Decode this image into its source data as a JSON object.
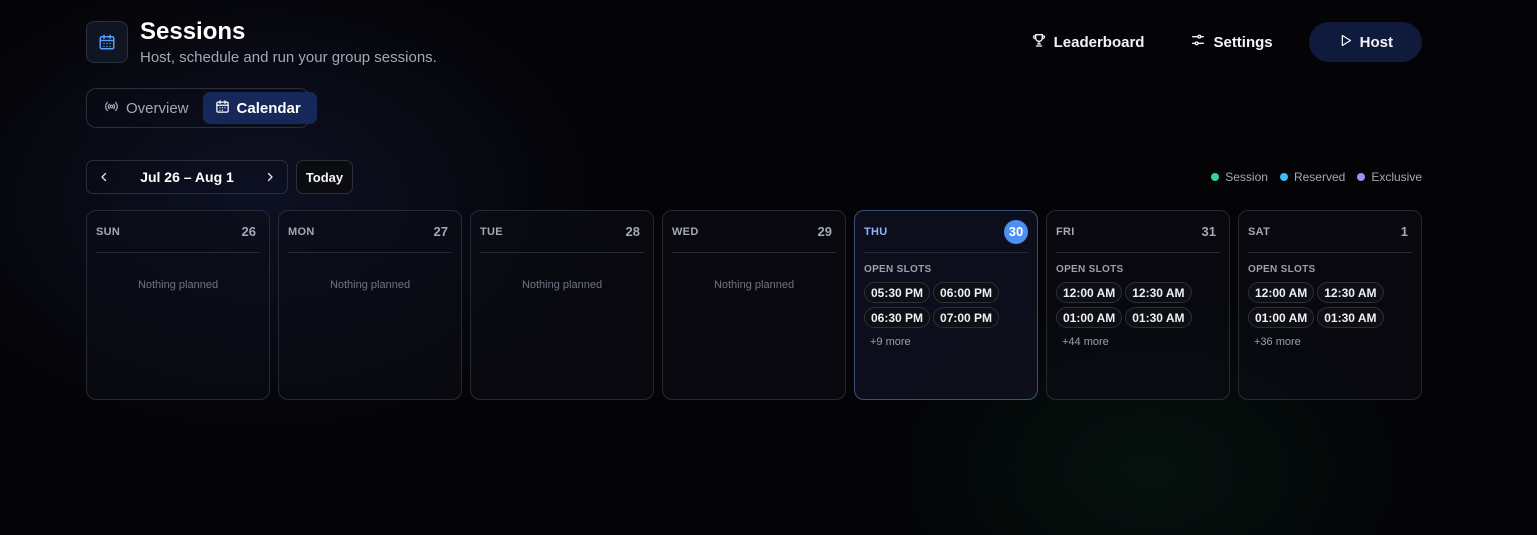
{
  "header": {
    "title": "Sessions",
    "subtitle": "Host, schedule and run your group sessions.",
    "actions": {
      "leaderboard": "Leaderboard",
      "settings": "Settings",
      "host": "Host"
    }
  },
  "tabs": [
    {
      "label": "Overview",
      "icon": "broadcast-icon",
      "active": false
    },
    {
      "label": "Calendar",
      "icon": "calendar-icon",
      "active": true
    }
  ],
  "range": {
    "label": "Jul 26 – Aug 1",
    "today": "Today"
  },
  "legend": [
    {
      "label": "Session",
      "color": "#34d399"
    },
    {
      "label": "Reserved",
      "color": "#38bdf8"
    },
    {
      "label": "Exclusive",
      "color": "#a78bfa"
    }
  ],
  "days": [
    {
      "dow": "SUN",
      "num": "26",
      "empty": "Nothing planned"
    },
    {
      "dow": "MON",
      "num": "27",
      "empty": "Nothing planned"
    },
    {
      "dow": "TUE",
      "num": "28",
      "empty": "Nothing planned"
    },
    {
      "dow": "WED",
      "num": "29",
      "empty": "Nothing planned"
    },
    {
      "dow": "THU",
      "num": "30",
      "slots_label": "OPEN SLOTS",
      "slots": [
        "05:30 PM",
        "06:00 PM",
        "06:30 PM",
        "07:00 PM"
      ],
      "more": "+9 more",
      "today": true
    },
    {
      "dow": "FRI",
      "num": "31",
      "slots_label": "OPEN SLOTS",
      "slots": [
        "12:00 AM",
        "12:30 AM",
        "01:00 AM",
        "01:30 AM"
      ],
      "more": "+44 more"
    },
    {
      "dow": "SAT",
      "num": "1",
      "slots_label": "OPEN SLOTS",
      "slots": [
        "12:00 AM",
        "12:30 AM",
        "01:00 AM",
        "01:30 AM"
      ],
      "more": "+36 more"
    }
  ],
  "colors": {
    "accent": "#4d8ef0",
    "host_button": "#101a3d",
    "active_tab": "#16275a"
  }
}
